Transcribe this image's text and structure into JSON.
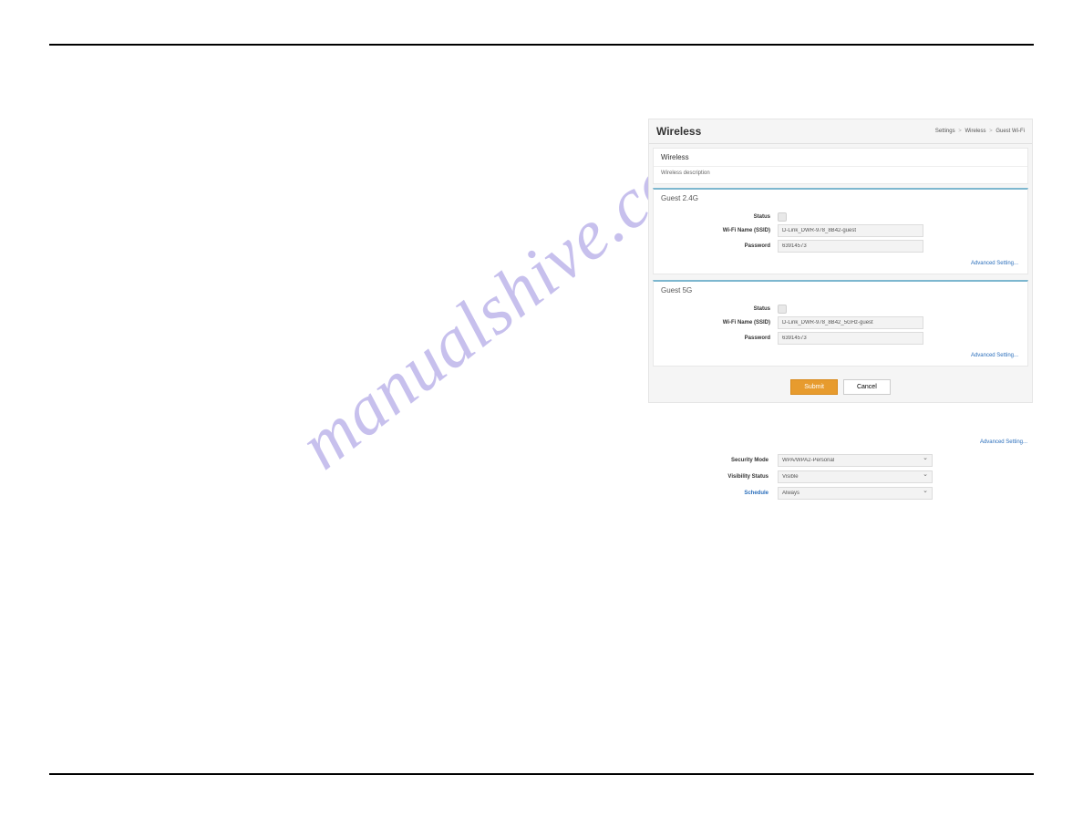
{
  "watermark": "manualshive.com",
  "router_ui": {
    "header": {
      "title": "Wireless",
      "breadcrumb": {
        "item1": "Settings",
        "item2": "Wireless",
        "item3": "Guest Wi-Fi"
      }
    },
    "wireless_section": {
      "heading": "Wireless",
      "description": "Wireless description"
    },
    "guest_24g": {
      "title": "Guest 2.4G",
      "status_label": "Status",
      "ssid_label": "Wi-Fi Name (SSID)",
      "ssid_value": "D-Link_DWR-978_8B42-guest",
      "password_label": "Password",
      "password_value": "63914573",
      "adv_link": "Advanced Setting..."
    },
    "guest_5g": {
      "title": "Guest 5G",
      "status_label": "Status",
      "ssid_label": "Wi-Fi Name (SSID)",
      "ssid_value": "D-Link_DWR-978_8B42_5GHz-guest",
      "password_label": "Password",
      "password_value": "63914573",
      "adv_link": "Advanced Setting..."
    },
    "buttons": {
      "submit": "Submit",
      "cancel": "Cancel"
    }
  },
  "adv_settings": {
    "adv_link": "Advanced Setting...",
    "security_mode_label": "Security Mode",
    "security_mode_value": "WPA/WPA2-Personal",
    "visibility_label": "Visibility Status",
    "visibility_value": "Visible",
    "schedule_label": "Schedule",
    "schedule_value": "Always"
  }
}
